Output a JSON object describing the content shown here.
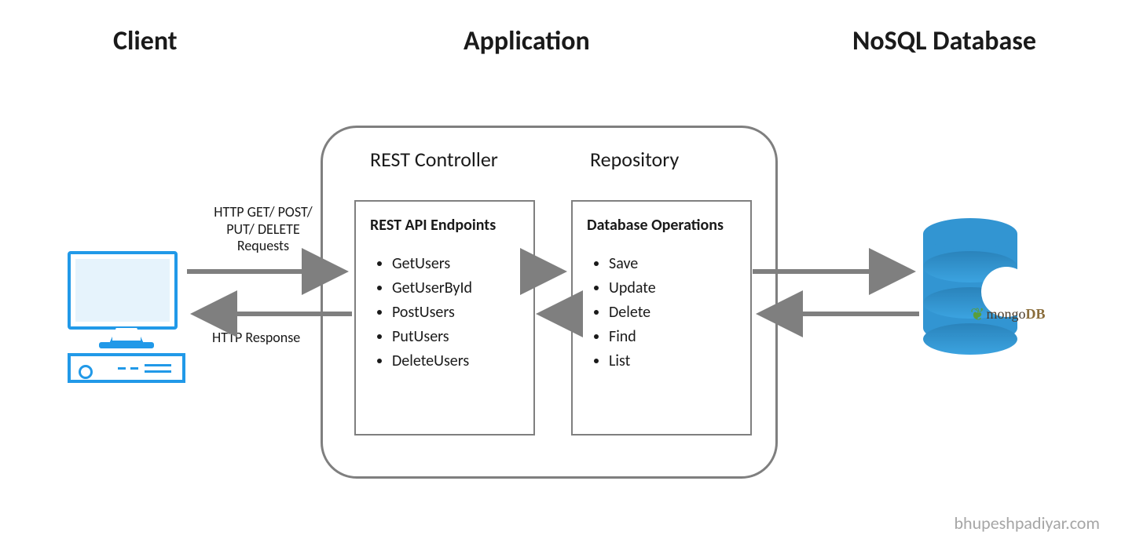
{
  "titles": {
    "client": "Client",
    "application": "Application",
    "database": "NoSQL Database"
  },
  "application": {
    "rest_controller": {
      "label": "REST Controller",
      "box_heading": "REST API Endpoints",
      "endpoints": [
        "GetUsers",
        "GetUserById",
        "PostUsers",
        "PutUsers",
        "DeleteUsers"
      ]
    },
    "repository": {
      "label": "Repository",
      "box_heading": "Database Operations",
      "operations": [
        "Save",
        "Update",
        "Delete",
        "Find",
        "List"
      ]
    }
  },
  "arrows": {
    "request_label": "HTTP GET/ POST/\nPUT/ DELETE\nRequests",
    "response_label": "HTTP Response"
  },
  "database": {
    "product_prefix": "mongo",
    "product_suffix": "DB"
  },
  "watermark": "bhupeshpadiyar.com",
  "colors": {
    "border_gray": "#7f7f7f",
    "client_blue": "#2199e8",
    "db_blue": "#3295d2",
    "mongo_green": "#5a9e3b"
  }
}
